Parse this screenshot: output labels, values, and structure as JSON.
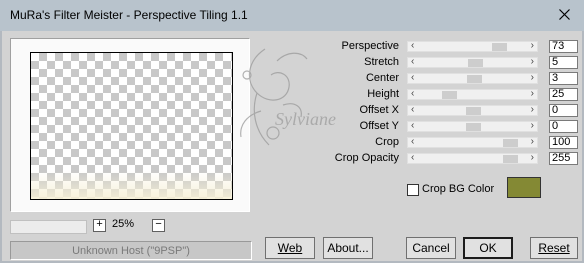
{
  "window": {
    "title": "MuRa's Filter Meister - Perspective Tiling 1.1",
    "close_icon": "close-icon"
  },
  "preview": {
    "zoom_minus": "−",
    "zoom_plus": "+",
    "zoom_level": "25%",
    "status": "Unknown Host (\"9PSP\")"
  },
  "watermark": {
    "text": "Sylviane"
  },
  "params": [
    {
      "label": "Perspective",
      "value": "73",
      "position": 0.78
    },
    {
      "label": "Stretch",
      "value": "5",
      "position": 0.52
    },
    {
      "label": "Center",
      "value": "3",
      "position": 0.51
    },
    {
      "label": "Height",
      "value": "25",
      "position": 0.24
    },
    {
      "label": "Offset X",
      "value": "0",
      "position": 0.5
    },
    {
      "label": "Offset Y",
      "value": "0",
      "position": 0.5
    },
    {
      "label": "Crop",
      "value": "100",
      "position": 0.9
    },
    {
      "label": "Crop Opacity",
      "value": "255",
      "position": 0.9
    }
  ],
  "crop_bg": {
    "label": "Crop BG Color",
    "checked": false,
    "color": "#848934"
  },
  "buttons": {
    "web": "Web",
    "about": "About...",
    "cancel": "Cancel",
    "ok": "OK",
    "reset": "Reset"
  }
}
